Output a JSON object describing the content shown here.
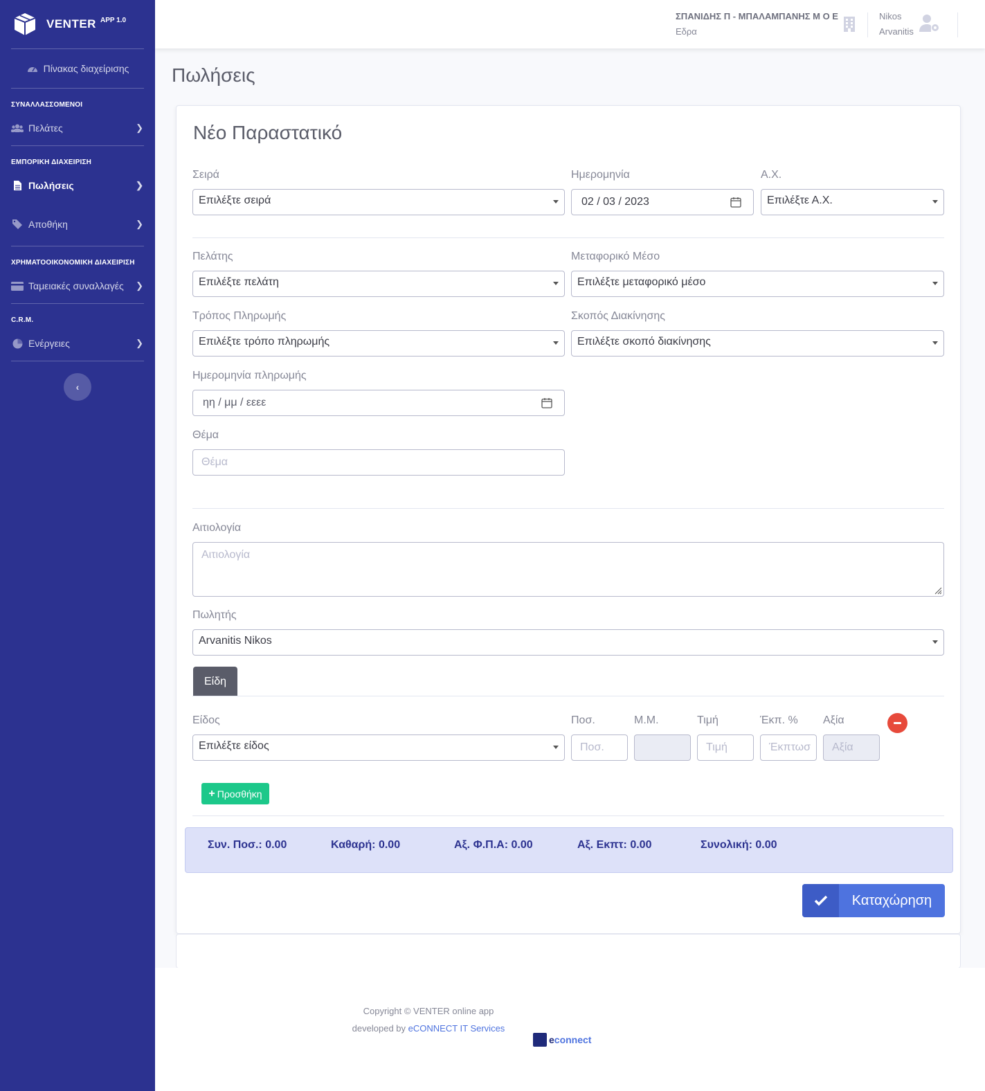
{
  "app": {
    "name": "VENTER",
    "version": "APP 1.0"
  },
  "sidebar": {
    "dashboard": "Πίνακας διαχείρισης",
    "sections": [
      {
        "heading": "ΣΥΝΑΛΛΑΣΣΟΜΕΝΟΙ",
        "items": [
          "Πελάτες"
        ]
      },
      {
        "heading": "ΕΜΠΟΡΙΚΗ ΔΙΑΧΕΙΡΙΣΗ",
        "items": [
          "Πωλήσεις",
          "Αποθήκη"
        ]
      },
      {
        "heading": "ΧΡΗΜΑΤΟΟΙΚΟΝΟΜΙΚΗ ΔΙΑΧΕΙΡΙΣΗ",
        "items": [
          "Ταμειακές συναλλαγές"
        ]
      },
      {
        "heading": "C.R.M.",
        "items": [
          "Ενέργειες"
        ]
      }
    ],
    "toggle": "‹"
  },
  "topbar": {
    "company": "ΣΠΑΝΙΔΗΣ Π - ΜΠΑΛΑΜΠΑΝΗΣ Μ Ο Ε",
    "branch": "Εδρα",
    "user_first": "Nikos",
    "user_last": "Arvanitis"
  },
  "page_title": "Πωλήσεις",
  "form": {
    "title": "Νέο Παραστατικό",
    "series_label": "Σειρά",
    "series_value": "Επιλέξτε σειρά",
    "date_label": "Ημερομηνία",
    "date_value": "02 / 03 / 2023",
    "ax_label": "Α.Χ.",
    "ax_value": "Επιλέξτε Α.Χ.",
    "customer_label": "Πελάτης",
    "customer_value": "Επιλέξτε πελάτη",
    "transport_label": "Μεταφορικό Μέσο",
    "transport_value": "Επιλέξτε μεταφορικό μέσο",
    "payment_label": "Τρόπος Πληρωμής",
    "payment_value": "Επιλέξτε τρόπο πληρωμής",
    "purpose_label": "Σκοπός Διακίνησης",
    "purpose_value": "Επιλέξτε σκοπό διακίνησης",
    "paydate_label": "Ημερομηνία πληρωμής",
    "paydate_placeholder": "ηη / μμ / εεεε",
    "subject_label": "Θέμα",
    "subject_placeholder": "Θέμα",
    "reason_label": "Αιτιολογία",
    "reason_placeholder": "Αιτιολογία",
    "seller_label": "Πωλητής",
    "seller_value": "Arvanitis Nikos",
    "tab_items": "Είδη",
    "item_label": "Είδος",
    "item_value": "Επιλέξτε είδος",
    "qty_label": "Ποσ.",
    "qty_placeholder": "Ποσ.",
    "mm_label": "Μ.Μ.",
    "price_label": "Τιμή",
    "price_placeholder": "Τιμή",
    "disc_label": "Έκπ. %",
    "disc_placeholder": "Έκπτωσ",
    "value_label": "Αξία",
    "value_placeholder": "Αξία",
    "add_button": "Προσθήκη",
    "save_button": "Καταχώρηση"
  },
  "totals": {
    "qty": "Συν. Ποσ.: 0.00",
    "net": "Καθαρή: 0.00",
    "vat": "Αξ. Φ.Π.Α: 0.00",
    "disc": "Αξ. Εκπτ: 0.00",
    "total": "Συνολική: 0.00"
  },
  "footer": {
    "copyright": "Copyright © VENTER online app",
    "developed_by": "developed by",
    "developer": "eCONNECT IT Services",
    "logo_text_e": "e",
    "logo_text": "connect"
  },
  "colors": {
    "sidebar": "#2c3290",
    "primary": "#4e73df",
    "success": "#1cc88a",
    "danger": "#e74a3b"
  }
}
